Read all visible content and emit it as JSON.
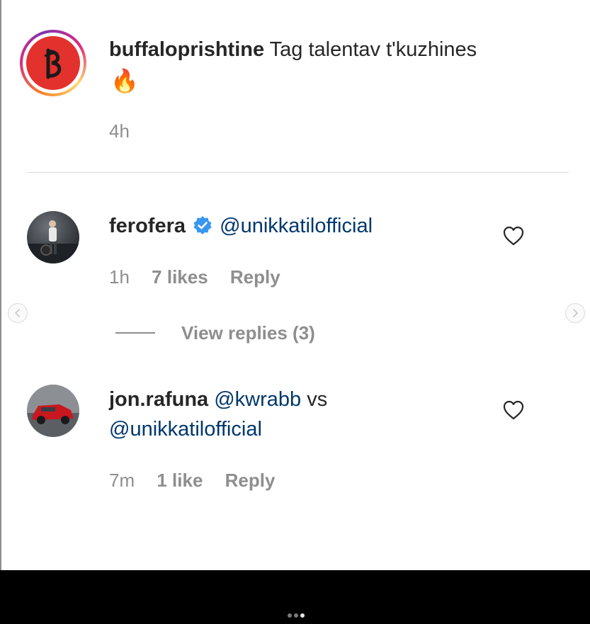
{
  "caption": {
    "username": "buffaloprishtine",
    "text": "Tag talentav t'kuzhines",
    "emoji": "🔥",
    "time": "4h"
  },
  "comments": [
    {
      "username": "ferofera",
      "verified": true,
      "text_mention": "@unikkatilofficial",
      "time": "1h",
      "likes": "7 likes",
      "reply": "Reply",
      "view_replies": "View replies (3)"
    },
    {
      "username": "jon.rafuna",
      "mention1": "@kwrabb",
      "vs": "vs",
      "mention2": "@unikkatilofficial",
      "time": "7m",
      "likes": "1 like",
      "reply": "Reply"
    }
  ],
  "colors": {
    "text": "#262626",
    "secondary": "#8e8e8e",
    "mention": "#00376b",
    "verified": "#3897f0",
    "brand_red": "#e3312d"
  },
  "icons": {
    "like": "heart-outline-icon",
    "verified": "verified-badge-icon",
    "prev": "chevron-left-icon",
    "next": "chevron-right-icon"
  },
  "carousel": {
    "count": 3,
    "active_index": 3
  }
}
